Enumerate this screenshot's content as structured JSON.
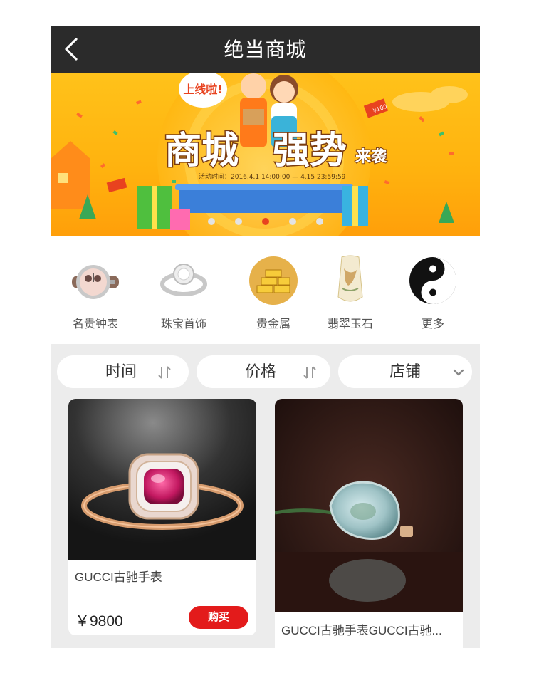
{
  "header": {
    "title": "绝当商城",
    "back_icon": "chevron-left-icon"
  },
  "banner": {
    "badge": "上线啦!",
    "headline_1": "商城",
    "headline_2": "强势",
    "headline_suffix": "来袭",
    "activity_time": "活动时间：2016.4.1 14:00:00 — 4.15 23:59:59",
    "coupon_text": "¥100",
    "slide_count": 5,
    "active_slide": 2,
    "colors": {
      "bg": "#ffb80f",
      "active_dot": "#e8421f"
    }
  },
  "categories": [
    {
      "label": "名贵钟表",
      "icon": "watch-icon"
    },
    {
      "label": "珠宝首饰",
      "icon": "ring-icon"
    },
    {
      "label": "贵金属",
      "icon": "gold-bars-icon"
    },
    {
      "label": "翡翠玉石",
      "icon": "jade-icon"
    },
    {
      "label": "更多",
      "icon": "yin-yang-icon"
    }
  ],
  "filters": [
    {
      "label": "时间",
      "icon": "sort-icon"
    },
    {
      "label": "价格",
      "icon": "sort-icon"
    },
    {
      "label": "店铺",
      "icon": "chevron-down-icon"
    }
  ],
  "products": [
    {
      "name": "GUCCI古驰手表",
      "price": "￥9800",
      "buy_label": "购买"
    },
    {
      "name": "GUCCI古驰手表GUCCI古驰..."
    }
  ],
  "colors": {
    "header": "#2b2b2b",
    "buy": "#e31b1b",
    "list_bg": "#ececec"
  }
}
